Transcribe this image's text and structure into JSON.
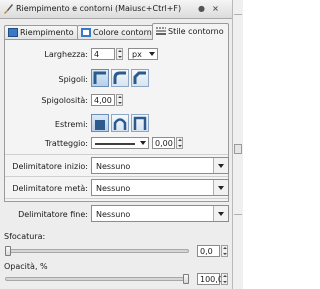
{
  "window": {
    "title": "Riempimento e contorni (Maiusc+Ctrl+F)"
  },
  "tabs": [
    {
      "label": "Riempimento"
    },
    {
      "label": "Colore contorno"
    },
    {
      "label": "Stile contorno"
    }
  ],
  "stroke_style": {
    "width_label": "Larghezza:",
    "width_value": "4",
    "unit_value": "px",
    "join_label": "Spigoli:",
    "miter_label": "Spigolosità:",
    "miter_value": "4,00",
    "cap_label": "Estremi:",
    "dash_label": "Tratteggio:",
    "dash_offset": "0,00",
    "start_marker_label": "Delimitatore inizio:",
    "start_marker_value": "Nessuno",
    "mid_marker_label": "Delimitatore metà:",
    "mid_marker_value": "Nessuno",
    "end_marker_label": "Delimitatore fine:",
    "end_marker_value": "Nessuno"
  },
  "blur": {
    "label": "Sfocatura:",
    "value": "0,0",
    "level": 0
  },
  "opacity": {
    "label": "Opacità, %",
    "value": "100,0",
    "level": 1.0
  },
  "colors": {
    "accent": "#6b8db5",
    "panel_bg": "#ededed"
  }
}
